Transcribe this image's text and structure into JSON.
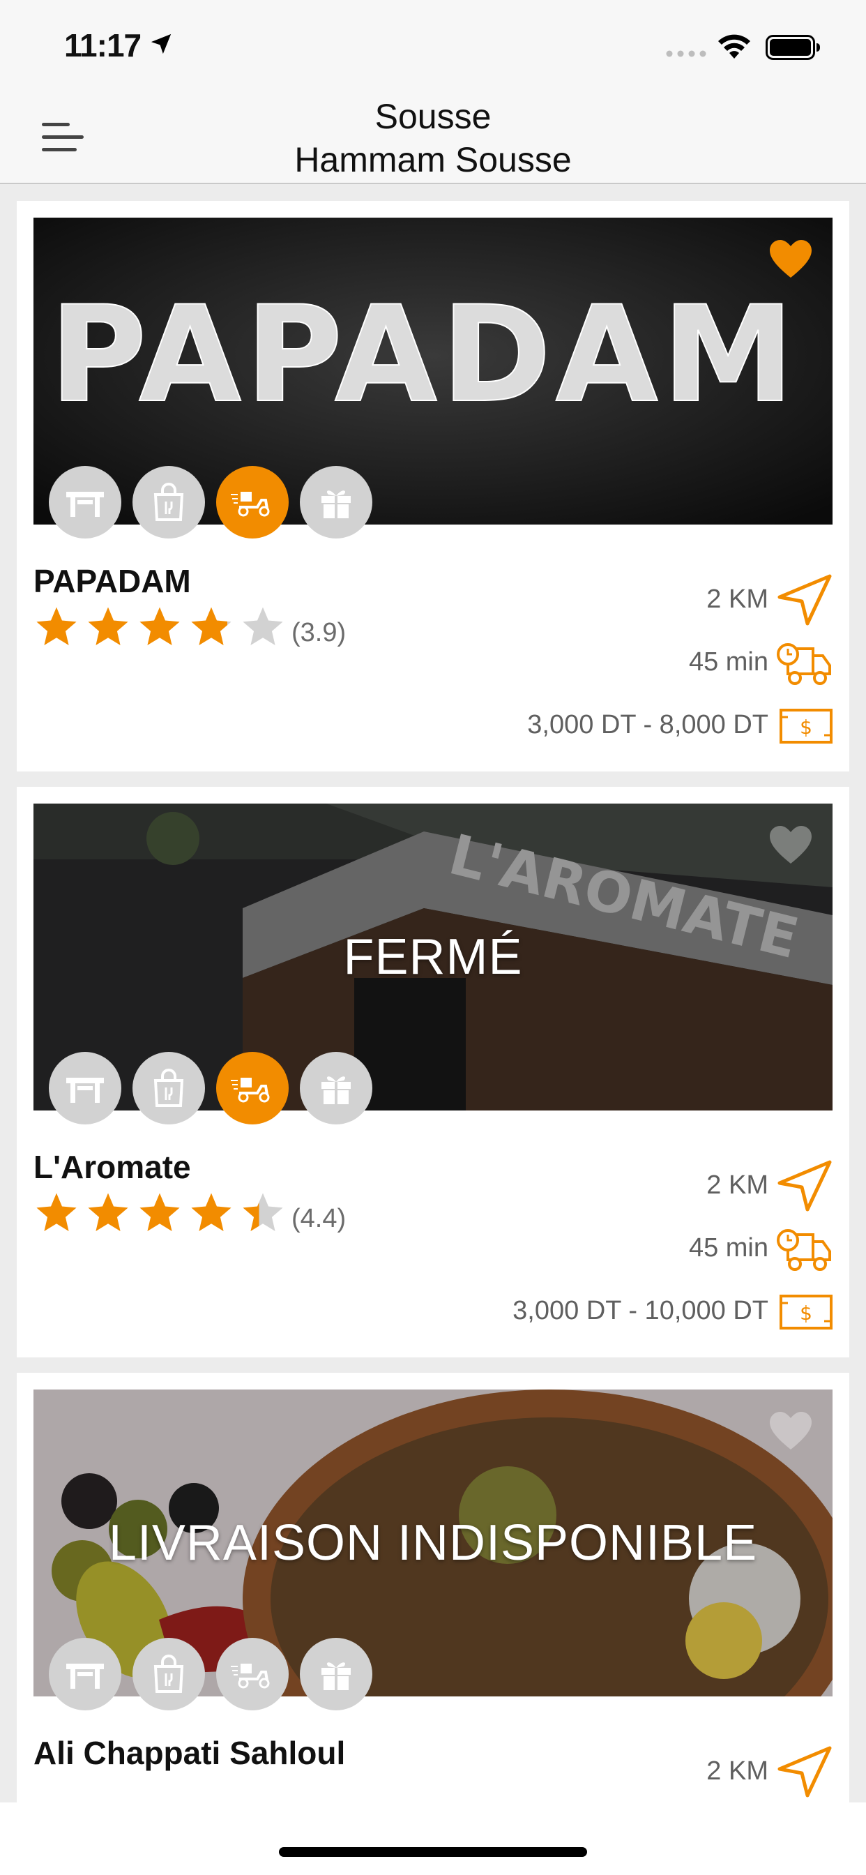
{
  "status_bar": {
    "time": "11:17"
  },
  "header": {
    "city": "Sousse",
    "district": "Hammam Sousse"
  },
  "labels": {
    "closed": "FERMÉ",
    "delivery_unavailable": "LIVRAISON INDISPONIBLE"
  },
  "colors": {
    "accent": "#f28c00",
    "inactive": "#d2d2d2"
  },
  "restaurants": [
    {
      "name": "PAPADAM",
      "photo_sign": "PAPADAM",
      "rating": "(3.9)",
      "rating_value": 3.9,
      "distance": "2 KM",
      "delivery_time": "45 min",
      "price_range": "3,000 DT - 8,000 DT",
      "favorite": true,
      "delivery_available": true
    },
    {
      "name": "L'Aromate",
      "photo_sign": "L'AROMATE",
      "rating": "(4.4)",
      "rating_value": 4.4,
      "distance": "2 KM",
      "delivery_time": "45 min",
      "price_range": "3,000 DT - 10,000 DT",
      "favorite": false,
      "delivery_available": true
    },
    {
      "name": "Ali Chappati Sahloul",
      "distance": "2 KM",
      "favorite": false,
      "delivery_available": false
    }
  ]
}
